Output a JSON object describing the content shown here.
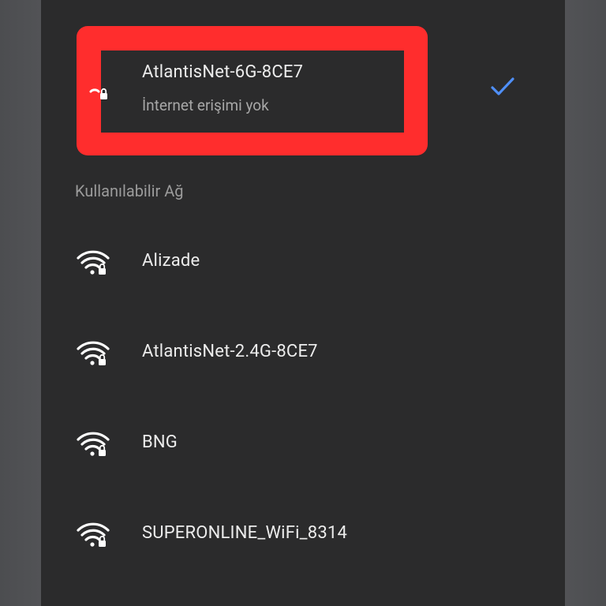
{
  "connected_network": {
    "name": "AtlantisNet-6G-8CE7",
    "status": "İnternet erişimi yok",
    "icon": "wifi-lock-icon",
    "connected_icon": "checkmark-icon"
  },
  "section_header": "Kullanılabilir Ağ",
  "available_networks": [
    {
      "name": "Alizade",
      "icon": "wifi-lock-icon"
    },
    {
      "name": "AtlantisNet-2.4G-8CE7",
      "icon": "wifi-lock-icon"
    },
    {
      "name": "BNG",
      "icon": "wifi-lock-icon"
    },
    {
      "name": "SUPERONLINE_WiFi_8314",
      "icon": "wifi-lock-icon"
    }
  ],
  "colors": {
    "sheet_background": "#2b2b2c",
    "highlight": "#ff2d2d",
    "check": "#4f8ff7",
    "text_primary": "#ececec",
    "text_secondary": "#a7a7a7"
  }
}
